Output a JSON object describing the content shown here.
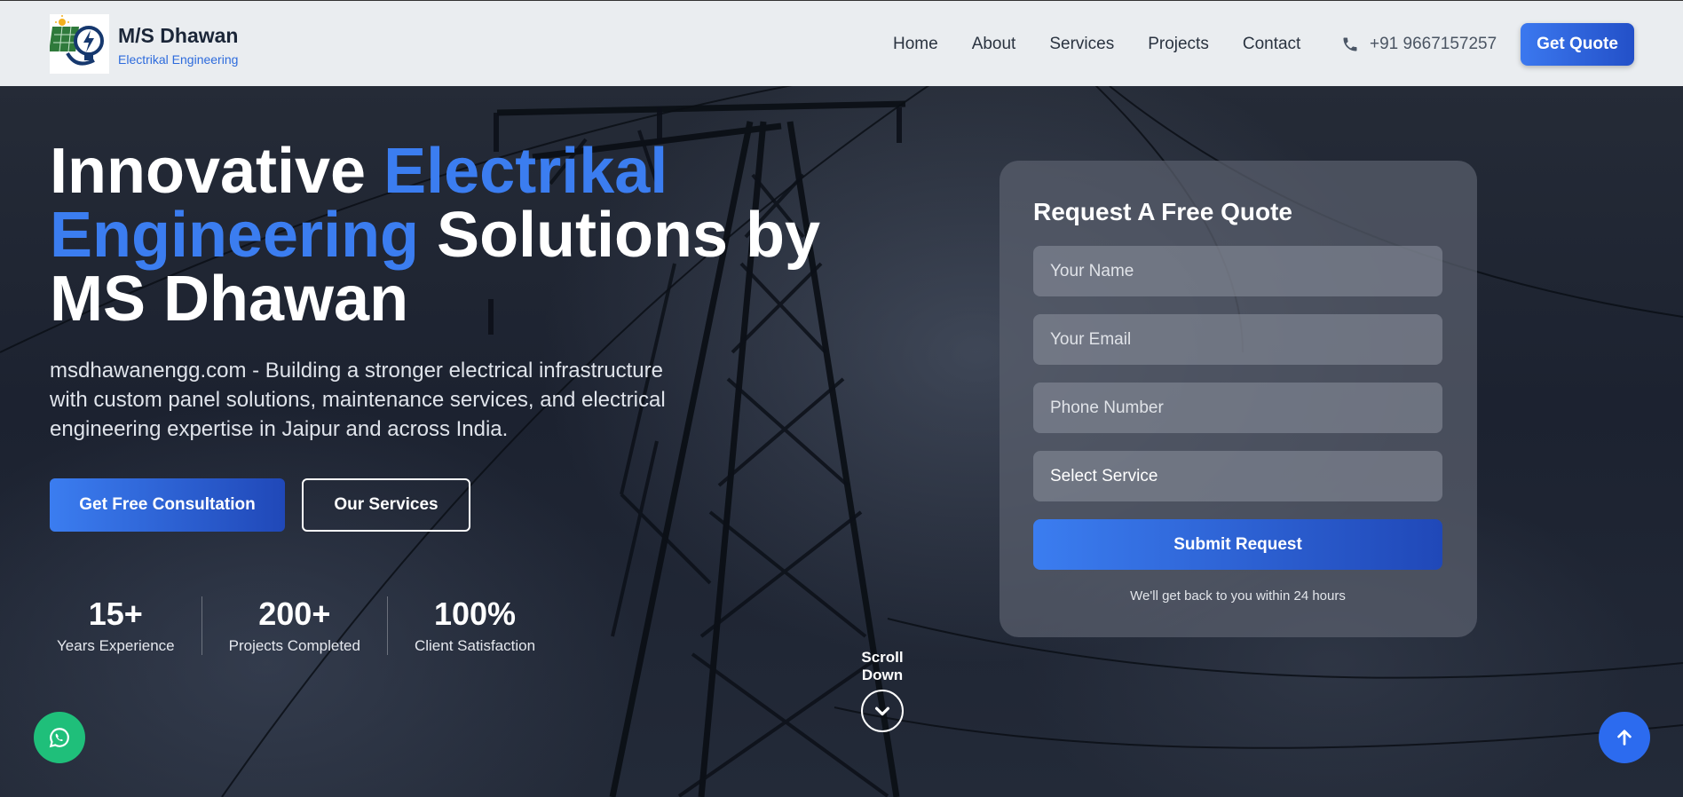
{
  "header": {
    "brand_name": "M/S Dhawan",
    "brand_tagline": "Electrikal Engineering",
    "nav": [
      "Home",
      "About",
      "Services",
      "Projects",
      "Contact"
    ],
    "phone": "+91 9667157257",
    "cta": "Get Quote"
  },
  "hero": {
    "title_part1": "Innovative ",
    "title_accent1": "Electrikal",
    "title_accent2": "Engineering",
    "title_part2": " Solutions by",
    "title_part3": "MS Dhawan",
    "lead": "msdhawanengg.com - Building a stronger electrical infrastructure with custom panel solutions, maintenance services, and electrical engineering expertise in Jaipur and across India.",
    "primary_button": "Get Free Consultation",
    "secondary_button": "Our Services",
    "stats": [
      {
        "value": "15+",
        "label": "Years Experience"
      },
      {
        "value": "200+",
        "label": "Projects Completed"
      },
      {
        "value": "100%",
        "label": "Client Satisfaction"
      }
    ],
    "scroll_label": "Scroll Down"
  },
  "quote_form": {
    "title": "Request A Free Quote",
    "name_placeholder": "Your Name",
    "email_placeholder": "Your Email",
    "phone_placeholder": "Phone Number",
    "service_select": "Select Service",
    "submit": "Submit Request",
    "note": "We'll get back to you within 24 hours"
  },
  "colors": {
    "accent": "#3b7df0",
    "whatsapp": "#1fbf7a",
    "scroll_top": "#2c6bef"
  },
  "icons": {
    "logo": "solar-bulb-logo",
    "phone": "phone-icon",
    "scroll": "chevron-down-icon",
    "whatsapp": "whatsapp-icon",
    "top": "arrow-up-icon"
  }
}
